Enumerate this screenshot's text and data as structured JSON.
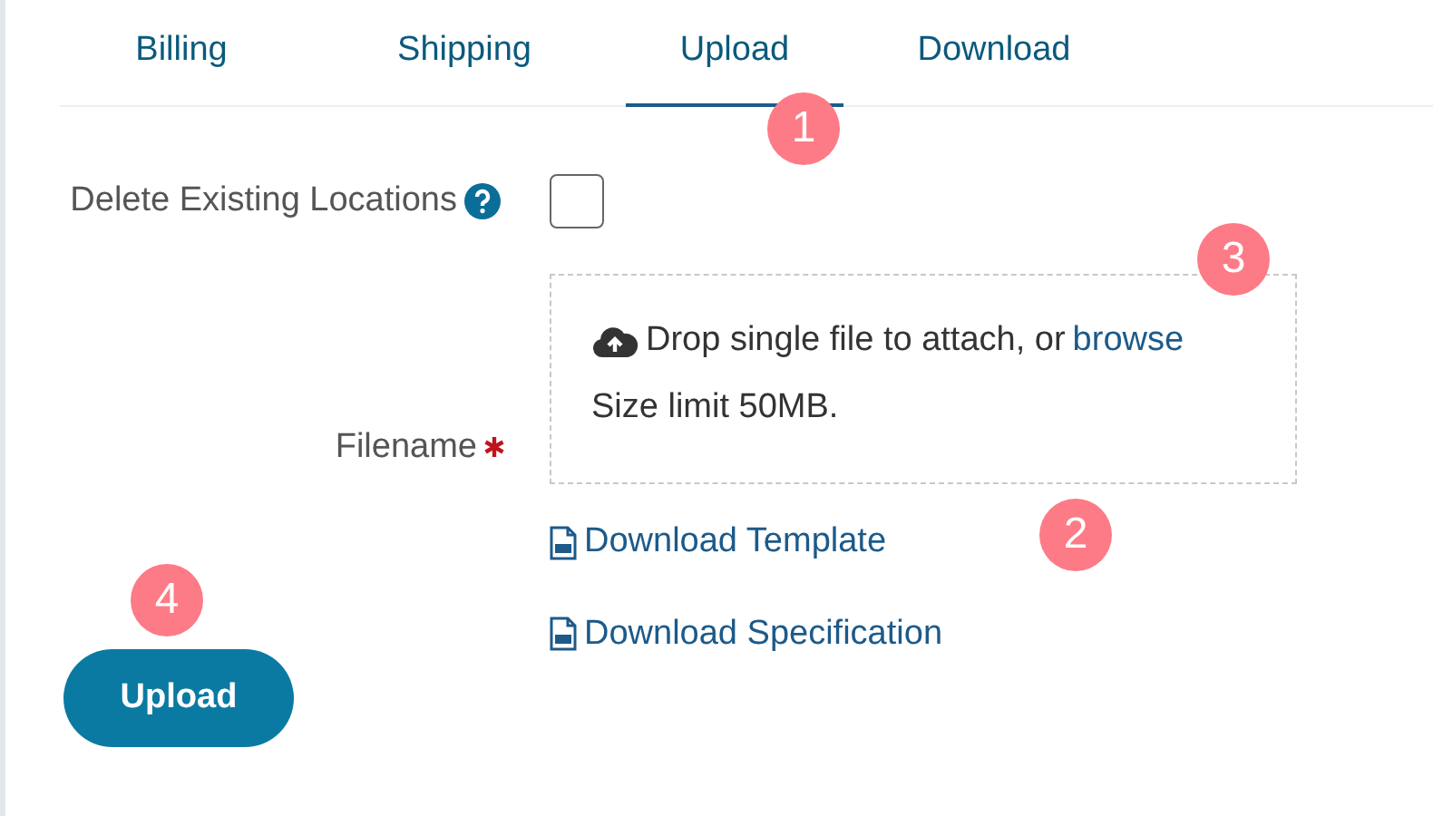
{
  "tabs": [
    {
      "label": "Billing",
      "selected": false
    },
    {
      "label": "Shipping",
      "selected": false
    },
    {
      "label": "Upload",
      "selected": true
    },
    {
      "label": "Download",
      "selected": false
    }
  ],
  "delete_existing": {
    "label": "Delete Existing Locations",
    "checked": false
  },
  "filename": {
    "label": "Filename",
    "required": true,
    "dropzone": {
      "text": "Drop single file to attach, or",
      "link": "browse",
      "hint": "Size limit 50MB."
    }
  },
  "links": [
    {
      "label": "Download Template"
    },
    {
      "label": "Download Specification"
    }
  ],
  "submit": {
    "label": "Upload"
  },
  "callouts": [
    {
      "label": "1"
    },
    {
      "label": "2"
    },
    {
      "label": "3"
    },
    {
      "label": "4"
    }
  ]
}
